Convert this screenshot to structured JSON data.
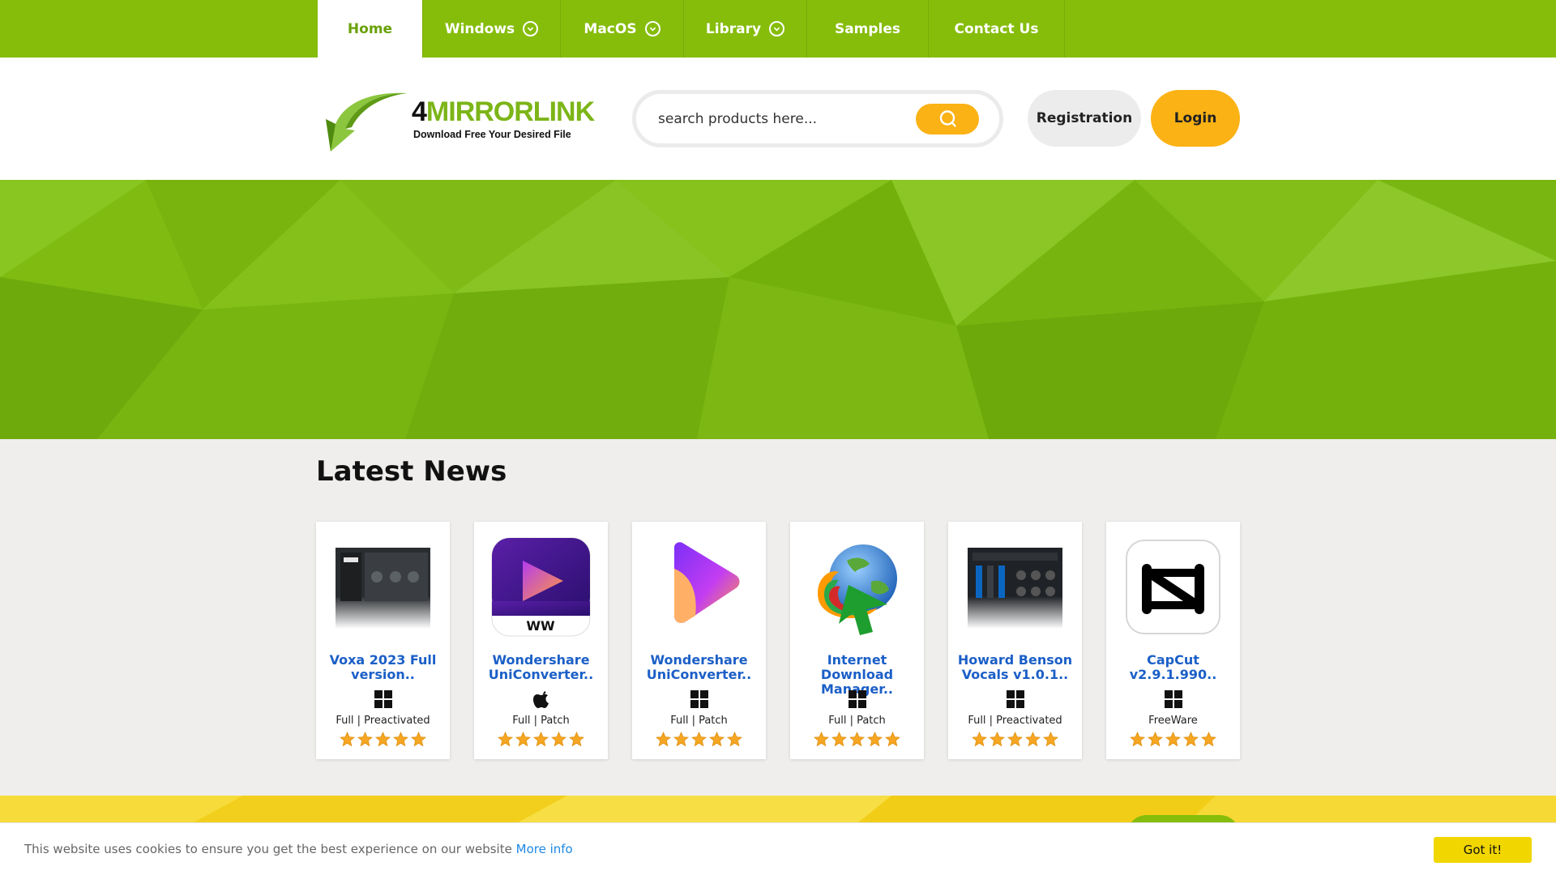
{
  "nav": {
    "items": [
      {
        "label": "Home",
        "active": true,
        "dropdown": false
      },
      {
        "label": "Windows",
        "active": false,
        "dropdown": true
      },
      {
        "label": "MacOS",
        "active": false,
        "dropdown": true
      },
      {
        "label": "Library",
        "active": false,
        "dropdown": true
      },
      {
        "label": "Samples",
        "active": false,
        "dropdown": false
      },
      {
        "label": "Contact Us",
        "active": false,
        "dropdown": false
      }
    ]
  },
  "header": {
    "logo_brand_prefix": "4",
    "logo_brand_rest": "MIRRORLINK",
    "logo_tagline": "Download Free Your Desired File",
    "search_placeholder": "search products here...",
    "registration_label": "Registration",
    "login_label": "Login"
  },
  "news": {
    "title": "Latest News",
    "cards": [
      {
        "name": "Voxa 2023 Full version..",
        "os": "windows-icon",
        "type": "Full | Preactivated",
        "rating": 5,
        "thumb": "voxa-plugin-image"
      },
      {
        "name": "Wondershare UniConverter..",
        "os": "apple-icon",
        "type": "Full | Patch",
        "rating": 5,
        "thumb": "uniconverter-mac-icon"
      },
      {
        "name": "Wondershare UniConverter..",
        "os": "windows-icon",
        "type": "Full | Patch",
        "rating": 5,
        "thumb": "uniconverter-icon"
      },
      {
        "name": "Internet Download Manager..",
        "os": "windows-icon",
        "type": "Full | Patch",
        "rating": 5,
        "thumb": "idm-globe-icon"
      },
      {
        "name": "Howard Benson Vocals v1.0.1..",
        "os": "windows-icon",
        "type": "Full | Preactivated",
        "rating": 5,
        "thumb": "howard-benson-plugin-image"
      },
      {
        "name": "CapCut v2.9.1.990..",
        "os": "windows-icon",
        "type": "FreeWare",
        "rating": 5,
        "thumb": "capcut-icon"
      }
    ]
  },
  "cookie": {
    "text": "This website uses cookies to ensure you get the best experience on our website",
    "link": "More info",
    "button": "Got it!"
  },
  "colors": {
    "brand_green": "#86bd0b",
    "accent_yellow": "#fbb214",
    "link_blue": "#1b5fc7",
    "star": "#f5a623"
  }
}
